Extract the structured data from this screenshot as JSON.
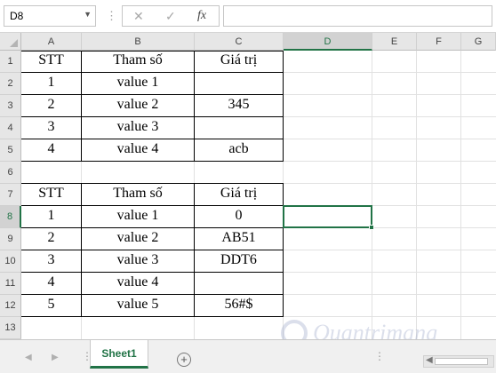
{
  "formula_bar": {
    "name_box": "D8",
    "separator": "⋮",
    "cancel_icon": "✕",
    "enter_icon": "✓",
    "fx_label": "fx",
    "formula": ""
  },
  "columns": [
    "A",
    "B",
    "C",
    "D",
    "E",
    "F",
    "G"
  ],
  "rows": [
    "1",
    "2",
    "3",
    "4",
    "5",
    "6",
    "7",
    "8",
    "9",
    "10",
    "11",
    "12",
    "13"
  ],
  "selected_cell": "D8",
  "table1": {
    "headers": [
      "STT",
      "Tham số",
      "Giá trị"
    ],
    "rows": [
      [
        "1",
        "value 1",
        ""
      ],
      [
        "2",
        "value 2",
        "345"
      ],
      [
        "3",
        "value 3",
        ""
      ],
      [
        "4",
        "value 4",
        "acb"
      ]
    ]
  },
  "table2": {
    "headers": [
      "STT",
      "Tham số",
      "Giá trị"
    ],
    "rows": [
      [
        "1",
        "value 1",
        "0"
      ],
      [
        "2",
        "value 2",
        "AB51"
      ],
      [
        "3",
        "value 3",
        "DDT6"
      ],
      [
        "4",
        "value 4",
        ""
      ],
      [
        "5",
        "value 5",
        "56#$"
      ]
    ]
  },
  "sheet_tabs": {
    "active": "Sheet1",
    "add_icon": "+",
    "dots": "⋮",
    "nav_prev": "◀",
    "nav_next": "▶",
    "scroll_left": "◀"
  },
  "watermark": {
    "text": "Quantrimang"
  },
  "colors": {
    "accent": "#217346",
    "header_bg": "#e6e6e6",
    "gridline": "#e1e1e1"
  }
}
